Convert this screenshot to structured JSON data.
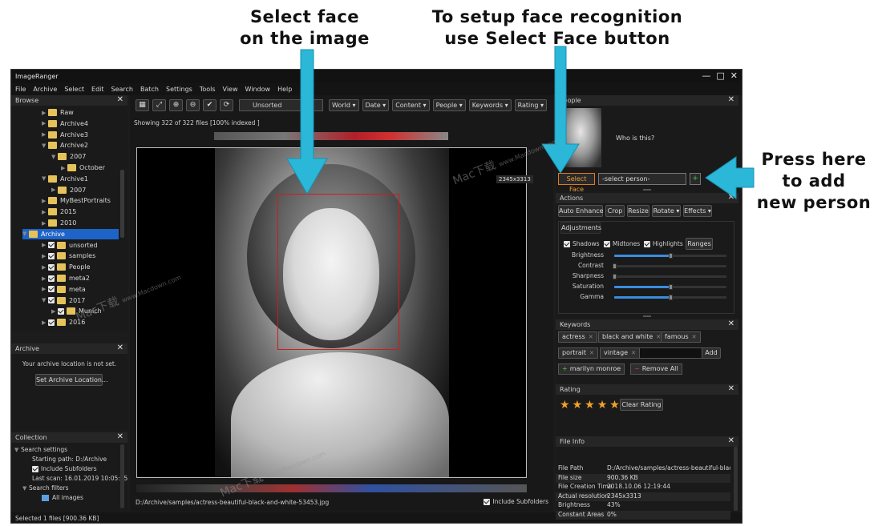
{
  "callouts": {
    "select_face_line1": "Select face",
    "select_face_line2": "on the image",
    "setup_line1": "To setup face recognition",
    "setup_line2": "use Select Face button",
    "press_line1": "Press here",
    "press_line2": "to add",
    "press_line3": "new person"
  },
  "window": {
    "title": "ImageRanger",
    "controls": [
      "—",
      "□",
      "✕"
    ]
  },
  "menu": [
    "File",
    "Archive",
    "Select",
    "Edit",
    "Search",
    "Batch",
    "Settings",
    "Tools",
    "View",
    "Window",
    "Help"
  ],
  "browse": {
    "title": "Browse",
    "tree": [
      {
        "label": "Raw",
        "indent": 2,
        "check": false
      },
      {
        "label": "Archive4",
        "indent": 2,
        "check": false
      },
      {
        "label": "Archive3",
        "indent": 2,
        "check": false
      },
      {
        "label": "Archive2",
        "indent": 2,
        "check": false,
        "open": true
      },
      {
        "label": "2007",
        "indent": 3,
        "check": false,
        "open": true
      },
      {
        "label": "October",
        "indent": 4,
        "check": false
      },
      {
        "label": "Archive1",
        "indent": 2,
        "check": false,
        "open": true
      },
      {
        "label": "2007",
        "indent": 3,
        "check": false
      },
      {
        "label": "MyBestPortraits",
        "indent": 2,
        "check": false
      },
      {
        "label": "2015",
        "indent": 2,
        "check": false
      },
      {
        "label": "2010",
        "indent": 2,
        "check": false
      },
      {
        "label": "Archive",
        "indent": 1,
        "check": false,
        "selected": true,
        "open": true
      },
      {
        "label": "unsorted",
        "indent": 2,
        "check": true
      },
      {
        "label": "samples",
        "indent": 2,
        "check": true
      },
      {
        "label": "People",
        "indent": 2,
        "check": true
      },
      {
        "label": "meta2",
        "indent": 2,
        "check": true
      },
      {
        "label": "meta",
        "indent": 2,
        "check": true
      },
      {
        "label": "2017",
        "indent": 2,
        "check": true,
        "open": true
      },
      {
        "label": "Munich",
        "indent": 3,
        "check": true
      },
      {
        "label": "2016",
        "indent": 2,
        "check": true
      }
    ]
  },
  "archive": {
    "title": "Archive",
    "message": "Your archive location is not set.",
    "button": "Set Archive Location..."
  },
  "collection": {
    "title": "Collection",
    "search_settings": "Search settings",
    "starting_path": "Starting path: D:/Archive",
    "include_subfolders": "Include Subfolders",
    "last_scan": "Last scan: 16.01.2019 10:05:35",
    "search_filters": "Search filters",
    "all_images": "All images"
  },
  "status": "Selected 1 files [900.36 KB]",
  "toolbar": {
    "icons": [
      "grid-icon",
      "fit-icon",
      "zoom-in-icon",
      "zoom-out-icon",
      "check-icon",
      "refresh-icon"
    ],
    "icon_glyphs": [
      "▦",
      "⤢",
      "⊕",
      "⊖",
      "✔",
      "⟳"
    ],
    "sort_value": "Unsorted",
    "dropdowns": [
      "World",
      "Date",
      "Content",
      "People",
      "Keywords",
      "Rating"
    ]
  },
  "viewer": {
    "showing": "Showing 322 of 322 files [100% indexed ]",
    "size_badge": "2345x3313",
    "path": "D:/Archive/samples/actress-beautiful-black-and-white-53453.jpg",
    "include_subfolders": "Include Subfolders"
  },
  "people": {
    "title": "People",
    "question": "Who is this?",
    "select_face": "Select Face",
    "select_person": "-select person-",
    "add": "+"
  },
  "actions": {
    "title": "Actions",
    "buttons": [
      "Auto Enhance",
      "Crop",
      "Resize",
      "Rotate",
      "Effects"
    ],
    "adjustments_tab": "Adjustments",
    "checks": [
      "Shadows",
      "Midtones",
      "Highlights"
    ],
    "ranges": "Ranges",
    "sliders": [
      {
        "label": "Brightness",
        "value": 0.5
      },
      {
        "label": "Contrast",
        "value": 0.0
      },
      {
        "label": "Sharpness",
        "value": 0.0
      },
      {
        "label": "Saturation",
        "value": 0.5
      },
      {
        "label": "Gamma",
        "value": 0.5
      }
    ]
  },
  "keywords": {
    "title": "Keywords",
    "tags": [
      "actress",
      "black and white",
      "famous",
      "portrait",
      "vintage"
    ],
    "add": "Add",
    "suggested": "marilyn monroe",
    "remove_all": "Remove All"
  },
  "rating": {
    "title": "Rating",
    "stars": 5,
    "clear": "Clear Rating"
  },
  "file_info": {
    "title": "File Info",
    "rows": [
      {
        "k": "File Path",
        "v": "D:/Archive/samples/actress-beautiful-black-..."
      },
      {
        "k": "File size",
        "v": "900.36 KB"
      },
      {
        "k": "File Creation Time",
        "v": "2018.10.06 12:19:44"
      },
      {
        "k": "Actual resolution",
        "v": "2345x3313"
      },
      {
        "k": "Brightness",
        "v": "43%"
      },
      {
        "k": "Constant Areas",
        "v": "0%"
      }
    ]
  },
  "watermark": "Mac下载",
  "watermark_sub": "www.Macdown.com",
  "colors": {
    "accent": "#1e63c8",
    "arrow": "#2bb8d8",
    "select_face": "#e07a1a",
    "face_rect": "#d01c1c",
    "star": "#f2a22a"
  }
}
